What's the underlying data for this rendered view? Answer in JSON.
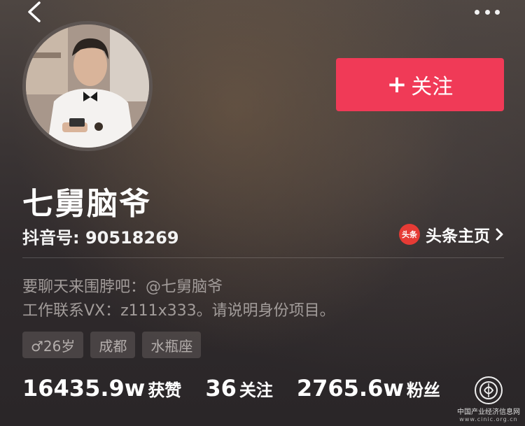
{
  "profile": {
    "name": "七舅脑爷",
    "douyin_id": "抖音号: 90518269",
    "follow_label": "关注",
    "toutiao_label": "头条主页",
    "toutiao_logo_text": "头条",
    "bio_line1": "要聊天来围脖吧：@七舅脑爷",
    "bio_line2": "工作联系VX：z111x333。请说明身份项目。"
  },
  "tags": [
    {
      "label": "♂26岁"
    },
    {
      "label": "成都"
    },
    {
      "label": "水瓶座"
    }
  ],
  "stats": [
    {
      "value": "16435.9w",
      "label": "获赞"
    },
    {
      "value": "36",
      "label": "关注"
    },
    {
      "value": "2765.6w",
      "label": "粉丝"
    }
  ],
  "watermark": {
    "cn": "中国产业经济信息网",
    "en": "www.cinic.org.cn"
  },
  "icons": {
    "back": "chevron-left-icon",
    "more": "more-horizontal-icon",
    "toutiao": "toutiao-logo-icon"
  },
  "colors": {
    "follow_button": "#f03a57",
    "toutiao_logo": "#e63b35"
  }
}
